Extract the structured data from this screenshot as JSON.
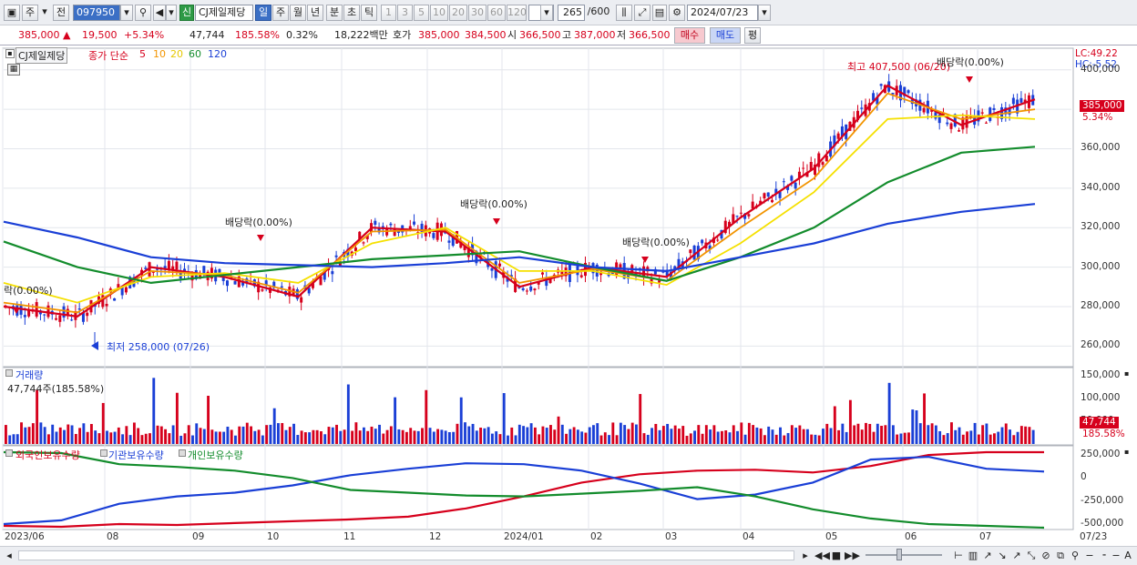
{
  "toolbar": {
    "market": "주",
    "prev_label": "전",
    "stock_code": "097950",
    "badge": "신",
    "stock_name": "CJ제일제당",
    "periods": [
      "일",
      "주",
      "월",
      "년",
      "분",
      "초",
      "틱"
    ],
    "active_period": "일",
    "minutes": [
      "1",
      "3",
      "5",
      "10",
      "20",
      "30",
      "60",
      "120"
    ],
    "count": "265",
    "count_total": "/600",
    "date": "2024/07/23"
  },
  "quote": {
    "price": "385,000",
    "arrow": "▲",
    "change": "19,500",
    "change_pct": "+5.34%",
    "volume": "47,744",
    "volume_ratio": "185.58%",
    "turnover": "0.32%",
    "amount": "18,222백만",
    "hoga_label": "호가",
    "ask": "385,000",
    "bid": "384,500",
    "open_label": "시",
    "open": "366,500",
    "high_label": "고",
    "high": "387,000",
    "low_label": "저",
    "low": "366,500",
    "buy": "매수",
    "sell": "매도",
    "avg": "평"
  },
  "legend": {
    "name": "CJ제일제당",
    "title": "종가 단순",
    "ma": [
      "5",
      "10",
      "20",
      "60",
      "120"
    ],
    "ma_colors": [
      "#d6001c",
      "#f29400",
      "#f5e000",
      "#138c2c",
      "#1a3fd6"
    ]
  },
  "price_axis": {
    "labels": [
      "400,000",
      "380,000",
      "360,000",
      "340,000",
      "320,000",
      "300,000",
      "280,000",
      "260,000"
    ],
    "lc": "LC:49.22",
    "hc": "HC:-5.52",
    "tag_price": "385,000",
    "tag_pct": "5.34%"
  },
  "annotations": {
    "high": "최고 407,500 (06/20)",
    "low": "최저 258,000 (07/26)",
    "dividend": "배당락(0.00%)",
    "dividend_left": "락(0.00%)"
  },
  "volume_panel": {
    "title": "거래량",
    "value": "47,744주(185.58%)",
    "labels": [
      "150,000",
      "100,000",
      "50,000"
    ],
    "tag_value": "47,744",
    "tag_pct": "185.58%"
  },
  "holdings_panel": {
    "series": [
      "외국인보유수량",
      "기관보유수량",
      "개인보유수량"
    ],
    "colors": [
      "#d6001c",
      "#1a3fd6",
      "#138c2c"
    ],
    "labels": [
      "250,000",
      "0",
      "-250,000",
      "-500,000"
    ]
  },
  "x_axis": {
    "labels": [
      "2023/06",
      "08",
      "09",
      "10",
      "11",
      "12",
      "2024/01",
      "02",
      "03",
      "04",
      "05",
      "06",
      "07",
      "07/23"
    ]
  },
  "colors": {
    "up": "#d6001c",
    "down": "#1a3fd6",
    "accent": "#3b6fc5"
  },
  "chart_data": {
    "type": "line",
    "title": "CJ제일제당",
    "ylim": [
      250000,
      410000
    ],
    "x": [
      "2023/06",
      "08",
      "09",
      "10",
      "11",
      "12",
      "2024/01",
      "02",
      "03",
      "04",
      "05",
      "06",
      "07",
      "07/23"
    ],
    "series": [
      {
        "name": "5",
        "values": [
          280000,
          275000,
          300000,
          295000,
          285000,
          320000,
          318000,
          290000,
          300000,
          295000,
          325000,
          350000,
          392000,
          372000,
          385000
        ]
      },
      {
        "name": "10",
        "values": [
          282000,
          277000,
          298000,
          296000,
          287000,
          318000,
          319000,
          292000,
          299000,
          293000,
          320000,
          345000,
          388000,
          375000,
          380000
        ]
      },
      {
        "name": "20",
        "values": [
          292000,
          282000,
          295000,
          297000,
          292000,
          312000,
          320000,
          298000,
          298000,
          291000,
          312000,
          338000,
          375000,
          377000,
          375000
        ]
      },
      {
        "name": "60",
        "values": [
          313000,
          300000,
          292000,
          296000,
          300000,
          304000,
          306000,
          308000,
          300000,
          293000,
          305000,
          320000,
          343000,
          358000,
          361000
        ]
      },
      {
        "name": "120",
        "values": [
          323000,
          315000,
          305000,
          302000,
          301000,
          300000,
          302000,
          305000,
          300000,
          298000,
          305000,
          312000,
          322000,
          328000,
          332000
        ]
      }
    ]
  }
}
